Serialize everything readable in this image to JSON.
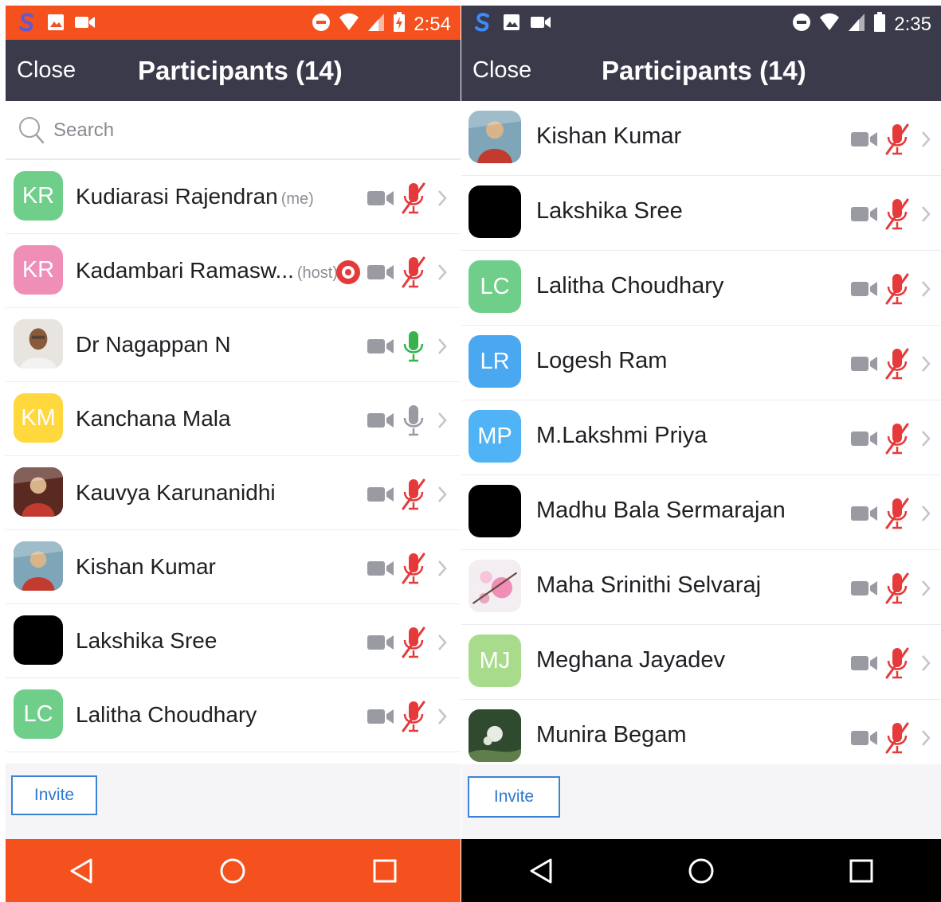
{
  "left": {
    "status": {
      "time": "2:54"
    },
    "header": {
      "close_label": "Close",
      "title": "Participants (14)"
    },
    "search": {
      "placeholder": "Search"
    },
    "participants": [
      {
        "initials": "KR",
        "name": "Kudiarasi Rajendran",
        "tag": "(me)",
        "avatar_color": "#6fcf8a",
        "mic": "muted",
        "recording": false
      },
      {
        "initials": "KR",
        "name": "Kadambari Ramasw...",
        "tag": "(host)",
        "avatar_color": "#ef8fb7",
        "mic": "muted",
        "recording": true
      },
      {
        "initials": "",
        "name": "Dr Nagappan N",
        "tag": "",
        "avatar_color": "#d9c7b3",
        "avatar_icon": "person-photo",
        "mic": "active",
        "recording": false
      },
      {
        "initials": "KM",
        "name": "Kanchana Mala",
        "tag": "",
        "avatar_color": "#ffd83d",
        "mic": "idle",
        "recording": false
      },
      {
        "initials": "",
        "name": "Kauvya Karunanidhi",
        "tag": "",
        "avatar_color": "#5a2a22",
        "avatar_icon": "profile-photo",
        "mic": "muted",
        "recording": false
      },
      {
        "initials": "",
        "name": "Kishan Kumar",
        "tag": "",
        "avatar_color": "#7fa6b8",
        "avatar_icon": "profile-photo",
        "mic": "muted",
        "recording": false
      },
      {
        "initials": "",
        "name": "Lakshika Sree",
        "tag": "",
        "avatar_color": "#000000",
        "mic": "muted",
        "recording": false
      },
      {
        "initials": "LC",
        "name": "Lalitha Choudhary",
        "tag": "",
        "avatar_color": "#6fcf8a",
        "mic": "muted",
        "recording": false
      }
    ],
    "footer": {
      "invite_label": "Invite"
    }
  },
  "right": {
    "status": {
      "time": "2:35"
    },
    "header": {
      "close_label": "Close",
      "title": "Participants (14)"
    },
    "participants": [
      {
        "initials": "",
        "name": "Kishan Kumar",
        "tag": "",
        "avatar_color": "#7fa6b8",
        "avatar_icon": "profile-photo",
        "mic": "muted"
      },
      {
        "initials": "",
        "name": "Lakshika Sree",
        "tag": "",
        "avatar_color": "#000000",
        "mic": "muted"
      },
      {
        "initials": "LC",
        "name": "Lalitha Choudhary",
        "tag": "",
        "avatar_color": "#6fcf8a",
        "mic": "muted"
      },
      {
        "initials": "LR",
        "name": "Logesh Ram",
        "tag": "",
        "avatar_color": "#4aa8f0",
        "mic": "muted"
      },
      {
        "initials": "MP",
        "name": "M.Lakshmi Priya",
        "tag": "",
        "avatar_color": "#4fb3f5",
        "mic": "muted"
      },
      {
        "initials": "",
        "name": "Madhu Bala Sermarajan",
        "tag": "",
        "avatar_color": "#000000",
        "mic": "muted"
      },
      {
        "initials": "",
        "name": "Maha Srinithi Selvaraj",
        "tag": "",
        "avatar_color": "#f4c6d8",
        "avatar_icon": "flower-photo",
        "mic": "muted"
      },
      {
        "initials": "MJ",
        "name": "Meghana Jayadev",
        "tag": "",
        "avatar_color": "#a8dc8c",
        "mic": "muted"
      },
      {
        "initials": "",
        "name": "Munira Begam",
        "tag": "",
        "avatar_color": "#3c5a3a",
        "avatar_icon": "nature-photo",
        "mic": "muted"
      }
    ],
    "footer": {
      "invite_label": "Invite"
    }
  },
  "colors": {
    "brand_orange": "#f4511e",
    "header_dark": "#3a3a4a",
    "muted_red": "#e5393a",
    "mic_green": "#37b24d",
    "invite_blue": "#2f78d0"
  }
}
